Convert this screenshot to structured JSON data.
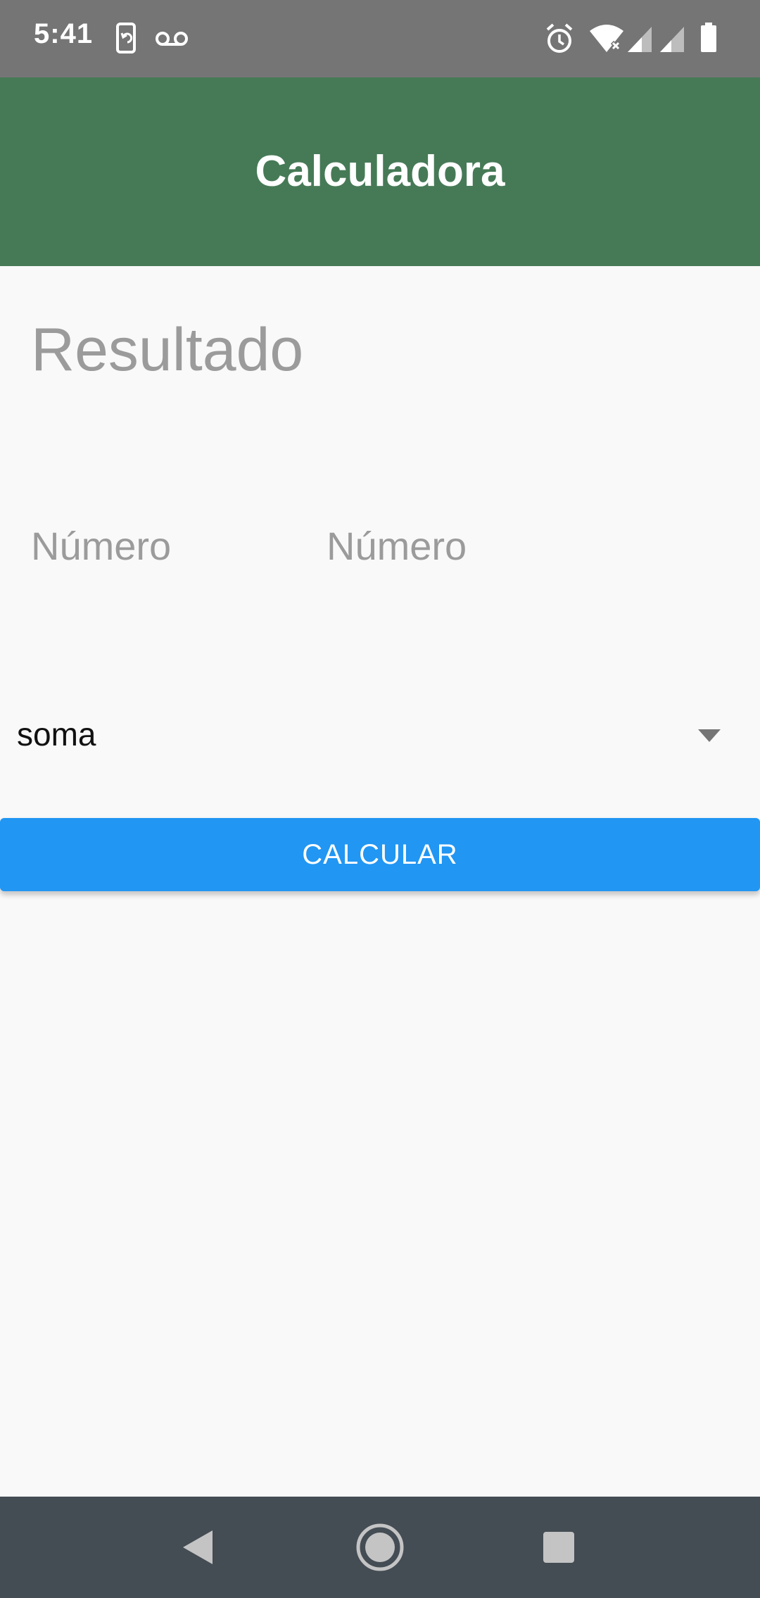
{
  "status_bar": {
    "time": "5:41",
    "icons": [
      "screen-rotate-icon",
      "voicemail-icon",
      "alarm-icon",
      "wifi-off-icon",
      "signal-icon",
      "signal-icon",
      "battery-icon"
    ],
    "background": "#757575"
  },
  "app_bar": {
    "title": "Calculadora",
    "background": "#467a56"
  },
  "content": {
    "result_label": "Resultado",
    "number_input_1": {
      "placeholder": "Número",
      "value": ""
    },
    "number_input_2": {
      "placeholder": "Número",
      "value": ""
    },
    "operation_dropdown": {
      "selected": "soma",
      "icon": "dropdown-arrow-icon"
    },
    "calculate_button": {
      "label": "CALCULAR",
      "color": "#2196f3"
    }
  },
  "nav_bar": {
    "buttons": [
      "back-icon",
      "home-icon",
      "recents-icon"
    ],
    "background": "#444c54"
  }
}
